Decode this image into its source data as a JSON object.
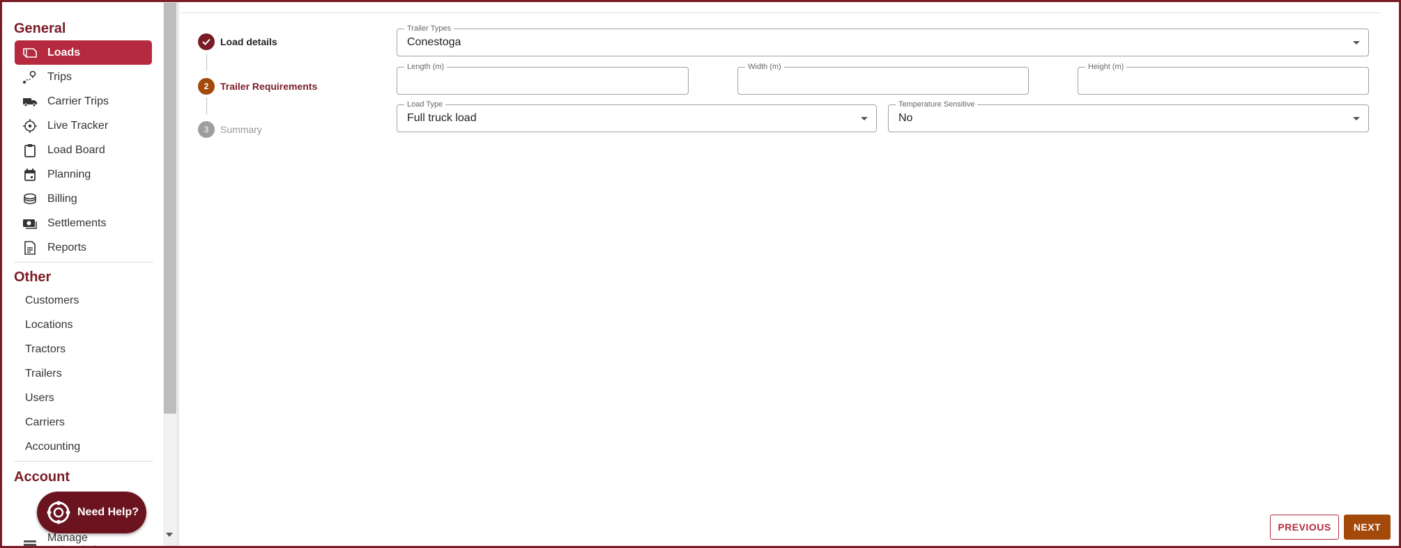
{
  "sidebar": {
    "general_title": "General",
    "general_items": [
      {
        "label": "Loads",
        "icon": "box-icon",
        "active": true
      },
      {
        "label": "Trips",
        "icon": "route-pin-icon"
      },
      {
        "label": "Carrier Trips",
        "icon": "truck-icon"
      },
      {
        "label": "Live Tracker",
        "icon": "crosshair-icon"
      },
      {
        "label": "Load Board",
        "icon": "clipboard-icon"
      },
      {
        "label": "Planning",
        "icon": "calendar-icon"
      },
      {
        "label": "Billing",
        "icon": "coins-icon"
      },
      {
        "label": "Settlements",
        "icon": "cash-icon"
      },
      {
        "label": "Reports",
        "icon": "document-icon"
      }
    ],
    "other_title": "Other",
    "other_items": [
      "Customers",
      "Locations",
      "Tractors",
      "Trailers",
      "Users",
      "Carriers",
      "Accounting"
    ],
    "account_title": "Account",
    "account_items": [
      {
        "label": "Manage Subscription",
        "icon": "card-icon"
      }
    ]
  },
  "help": {
    "label": "Need Help?",
    "icon": "lifebuoy-icon"
  },
  "stepper": [
    {
      "label": "Load details",
      "state": "completed",
      "marker": "✓"
    },
    {
      "label": "Trailer Requirements",
      "state": "active",
      "marker": "2"
    },
    {
      "label": "Summary",
      "state": "pending",
      "marker": "3"
    }
  ],
  "form": {
    "trailer_types": {
      "label": "Trailer Types",
      "value": "Conestoga"
    },
    "length": {
      "label": "Length (m)",
      "value": ""
    },
    "width": {
      "label": "Width (m)",
      "value": ""
    },
    "height": {
      "label": "Height (m)",
      "value": ""
    },
    "load_type": {
      "label": "Load Type",
      "value": "Full truck load"
    },
    "temperature_sensitive": {
      "label": "Temperature Sensitive",
      "value": "No"
    }
  },
  "actions": {
    "previous": "PREVIOUS",
    "next": "NEXT"
  },
  "colors": {
    "brand": "#7a1c26",
    "active_nav": "#b52a3f",
    "step_active": "#a34a0b",
    "next_button": "#a34a0b",
    "help_button": "#6b1420"
  }
}
